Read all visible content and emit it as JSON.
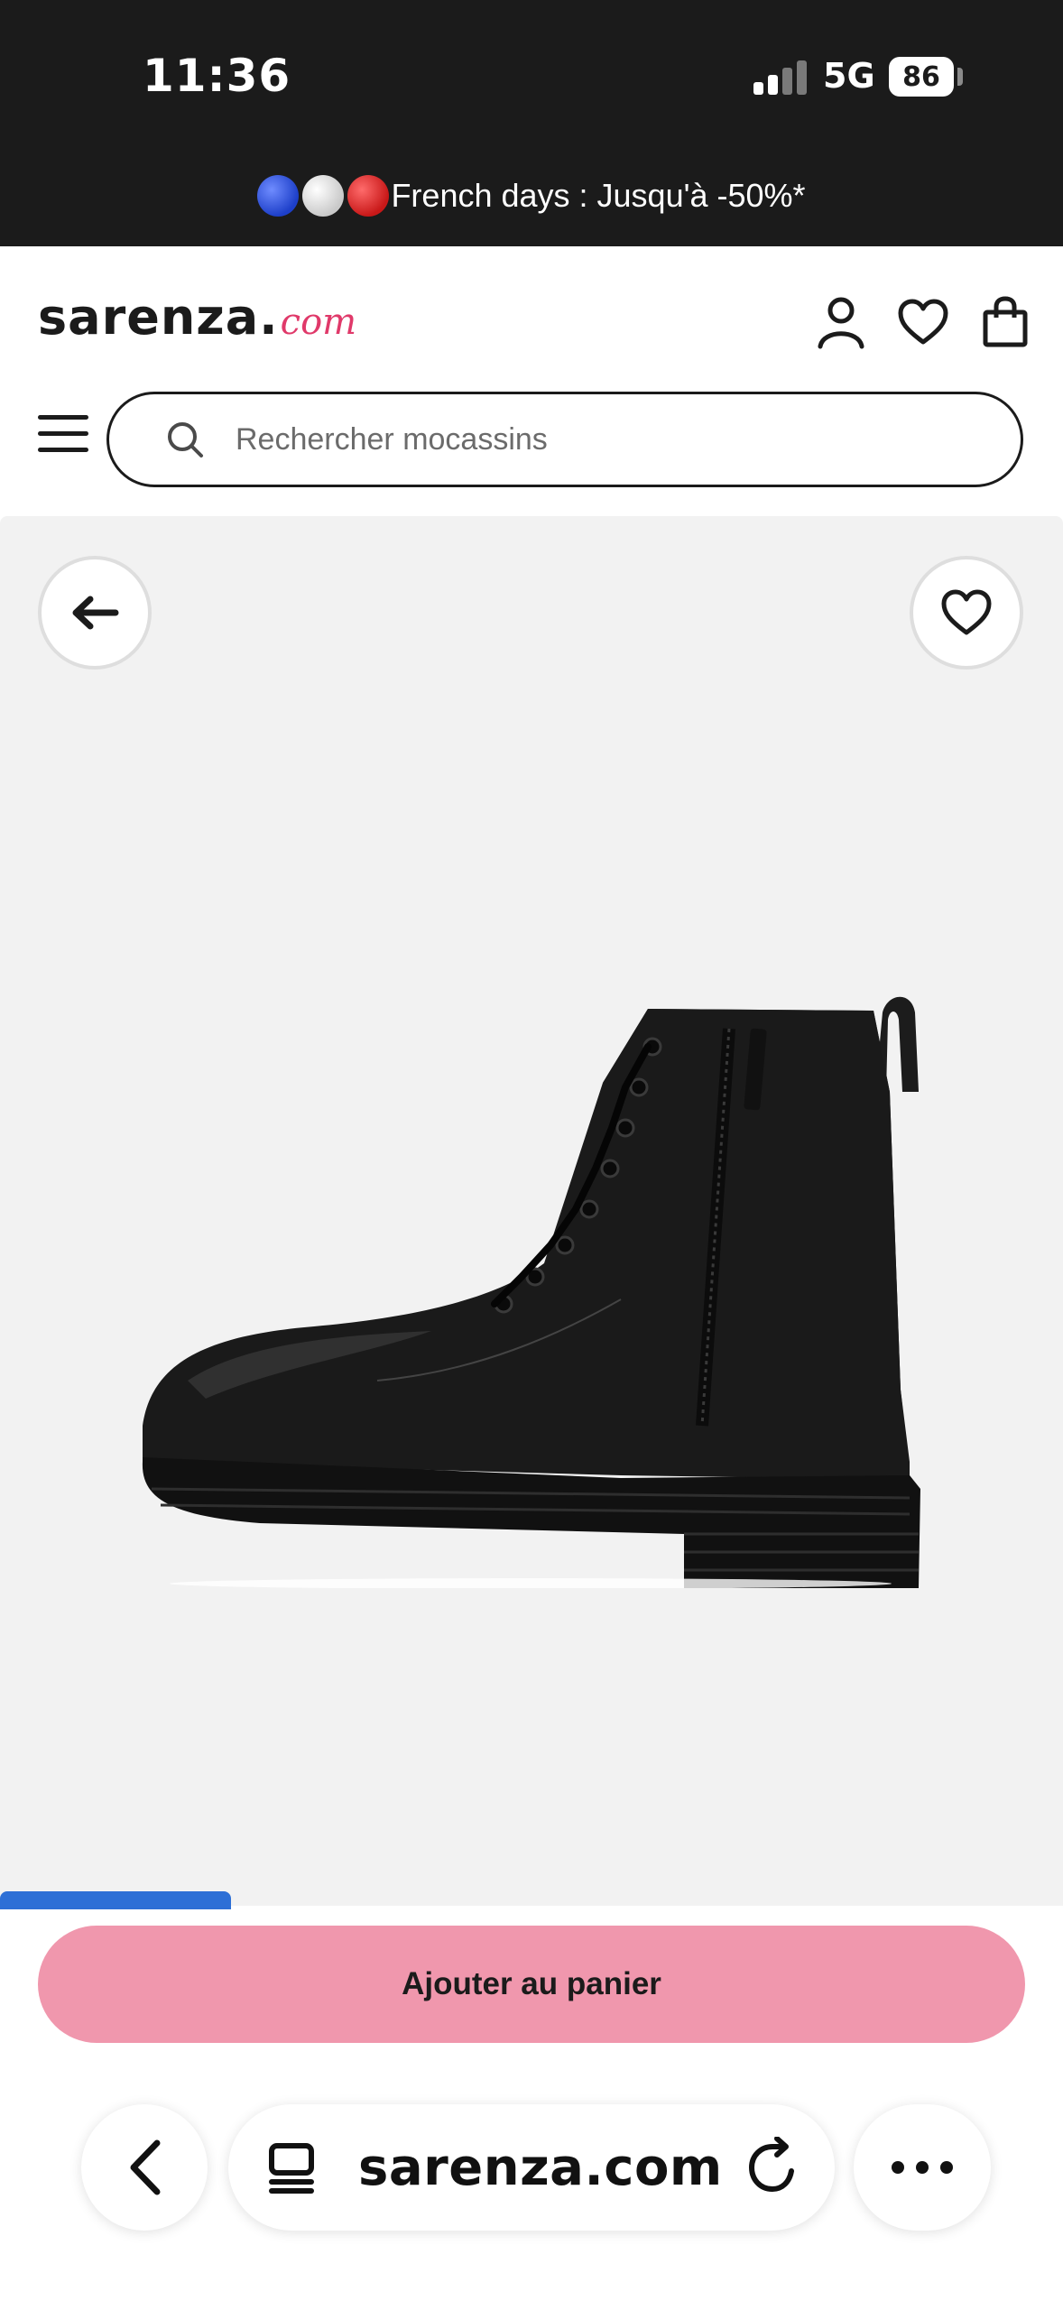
{
  "status_bar": {
    "time": "11:36",
    "network": "5G",
    "battery": "86"
  },
  "promo": {
    "text": "French days : Jusqu'à -50%*",
    "icons": [
      "blue-ball",
      "white-ball",
      "red-ball"
    ]
  },
  "header": {
    "logo_main": "sarenza.",
    "logo_suffix": "com",
    "icons": [
      "account-icon",
      "wishlist-heart-icon",
      "shopping-bag-icon"
    ]
  },
  "search": {
    "placeholder": "Rechercher mocassins"
  },
  "product": {
    "image": "black-leather-lace-up-ankle-boot",
    "back_icon": "arrow-left-icon",
    "favorite_icon": "heart-icon"
  },
  "cart": {
    "add_label": "Ajouter au panier"
  },
  "browser": {
    "url": "sarenza.com",
    "icons": [
      "back-chevron-icon",
      "tabs-icon",
      "reload-icon",
      "more-dots-icon"
    ]
  },
  "colors": {
    "dark_bar": "#1b1b1b",
    "accent_pink": "#f097ad",
    "logo_pink": "#e0396a",
    "image_background": "#f2f2f2",
    "blue_tab": "#2d6fd6"
  }
}
